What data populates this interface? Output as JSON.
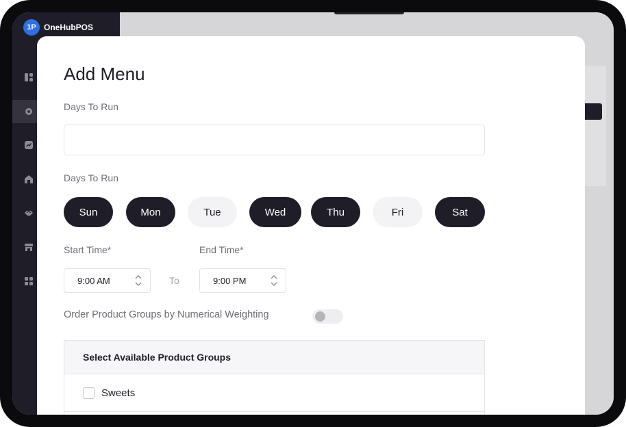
{
  "app": {
    "name": "OneHubPOS",
    "logo_text": "1P"
  },
  "sidebar": {
    "icons": [
      "dashboard-icon",
      "settings-icon",
      "reports-icon",
      "store-icon",
      "handshake-icon",
      "shop-icon",
      "apps-icon"
    ],
    "active_index": 1
  },
  "modal": {
    "title": "Add Menu",
    "days_field_label": "Days To Run",
    "days_field_value": "",
    "days_select_label": "Days To Run",
    "days": [
      {
        "label": "Sun",
        "selected": true
      },
      {
        "label": "Mon",
        "selected": true
      },
      {
        "label": "Tue",
        "selected": false
      },
      {
        "label": "Wed",
        "selected": true
      },
      {
        "label": "Thu",
        "selected": true
      },
      {
        "label": "Fri",
        "selected": false
      },
      {
        "label": "Sat",
        "selected": true
      }
    ],
    "start_time_label": "Start Time*",
    "start_time_value": "9:00 AM",
    "to_label": "To",
    "end_time_label": "End Time*",
    "end_time_value": "9:00 PM",
    "weighting_label": "Order Product Groups by Numerical Weighting",
    "weighting_enabled": false,
    "groups_header": "Select Available Product Groups",
    "groups": [
      {
        "label": "Sweets",
        "checked": false
      }
    ]
  },
  "colors": {
    "dark": "#1f1d28",
    "brand_blue": "#2f6fe0",
    "muted_text": "#6e6d75",
    "chip_off": "#f3f3f5"
  }
}
